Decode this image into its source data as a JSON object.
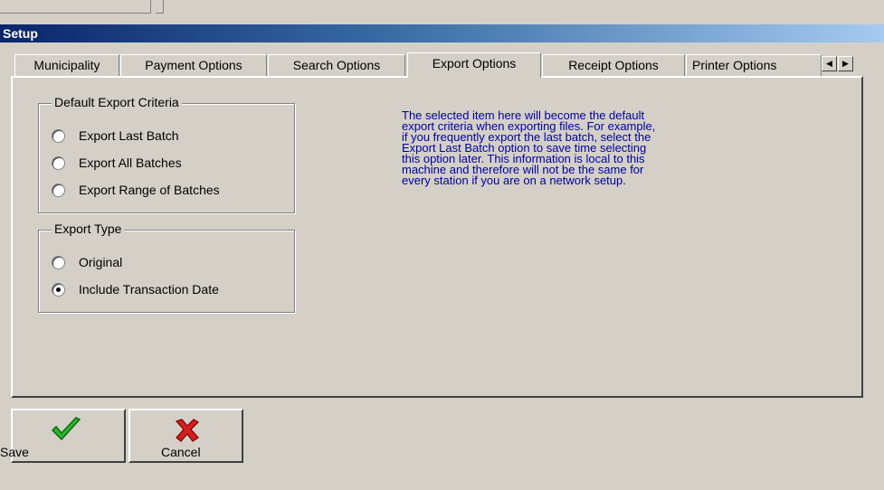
{
  "window": {
    "title": "Setup"
  },
  "tabs": [
    {
      "label": "Municipality"
    },
    {
      "label": "Payment Options"
    },
    {
      "label": "Search Options"
    },
    {
      "label": "Export Options"
    },
    {
      "label": "Receipt Options"
    },
    {
      "label": "Printer Options"
    }
  ],
  "active_tab": "Export Options",
  "criteria_group": {
    "legend": "Default Export Criteria",
    "options": [
      {
        "label": "Export Last Batch",
        "selected": false
      },
      {
        "label": "Export All Batches",
        "selected": false
      },
      {
        "label": "Export Range of Batches",
        "selected": false
      }
    ]
  },
  "type_group": {
    "legend": "Export Type",
    "options": [
      {
        "label": "Original",
        "selected": false
      },
      {
        "label": "Include Transaction Date",
        "selected": true
      }
    ]
  },
  "info_lines": [
    "The selected item here will become the default",
    "export criteria when exporting files.  For example,",
    "if you frequently export the last batch, select the",
    "Export Last Batch option to save time selecting",
    "this option later.  This information is local to this",
    "machine and therefore will not be the same for",
    "every station if you are on a network setup."
  ],
  "buttons": {
    "save": "Save",
    "cancel": "Cancel"
  },
  "colors": {
    "info_text": "#0000a0",
    "titlebar_start": "#0a246a",
    "titlebar_end": "#a6caf0"
  },
  "icons": {
    "save": "green-checkmark-icon",
    "cancel": "red-x-icon",
    "tab_left": "left-arrow-icon",
    "tab_right": "right-arrow-icon"
  }
}
